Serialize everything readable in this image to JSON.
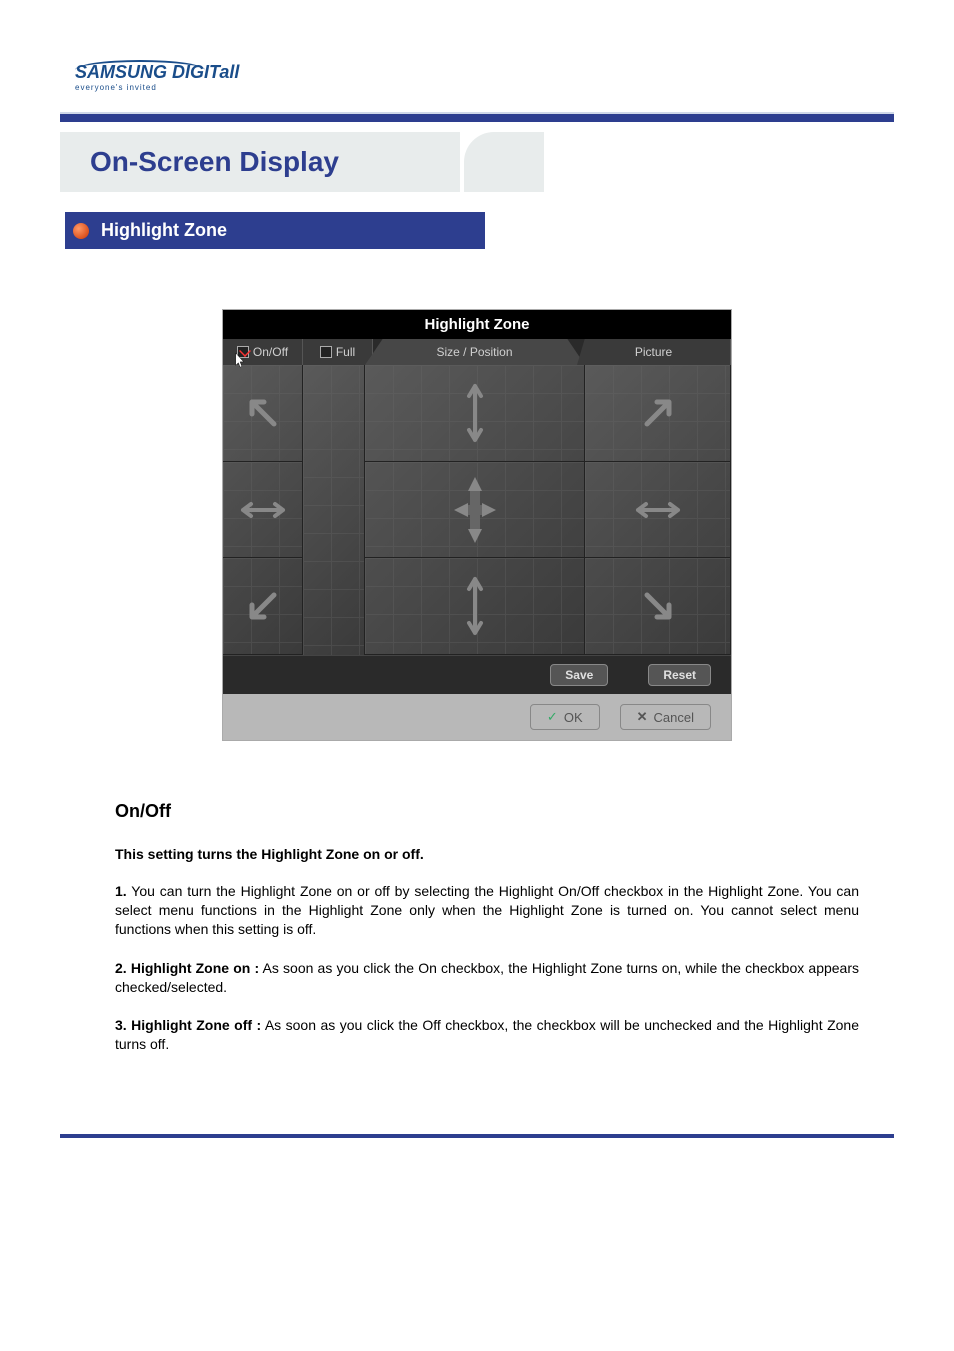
{
  "logo": {
    "main": "SAMSUNG DIGITall",
    "sub": "everyone's invited"
  },
  "page_title": "On-Screen Display",
  "section_title": "Highlight Zone",
  "screenshot": {
    "title": "Highlight Zone",
    "tabs": {
      "onoff": "On/Off",
      "full": "Full",
      "size": "Size / Position",
      "picture": "Picture"
    },
    "buttons": {
      "save": "Save",
      "reset": "Reset",
      "ok": "OK",
      "cancel": "Cancel"
    }
  },
  "content": {
    "heading": "On/Off",
    "subtitle": "This setting turns the Highlight Zone on or off.",
    "p1_num": "1.",
    "p1": " You can turn the Highlight Zone on or off by selecting the Highlight On/Off checkbox in the Highlight Zone. You can select menu functions in the Highlight Zone only when the Highlight Zone is turned on. You cannot select menu functions when this setting is off.",
    "p2_bold": "2. Highlight Zone on :",
    "p2": " As soon as you click the On checkbox, the Highlight Zone turns on, while the checkbox appears checked/selected.",
    "p3_bold": "3. Highlight Zone off :",
    "p3": " As soon as you click the Off checkbox, the checkbox will be unchecked and the Highlight Zone turns off."
  }
}
